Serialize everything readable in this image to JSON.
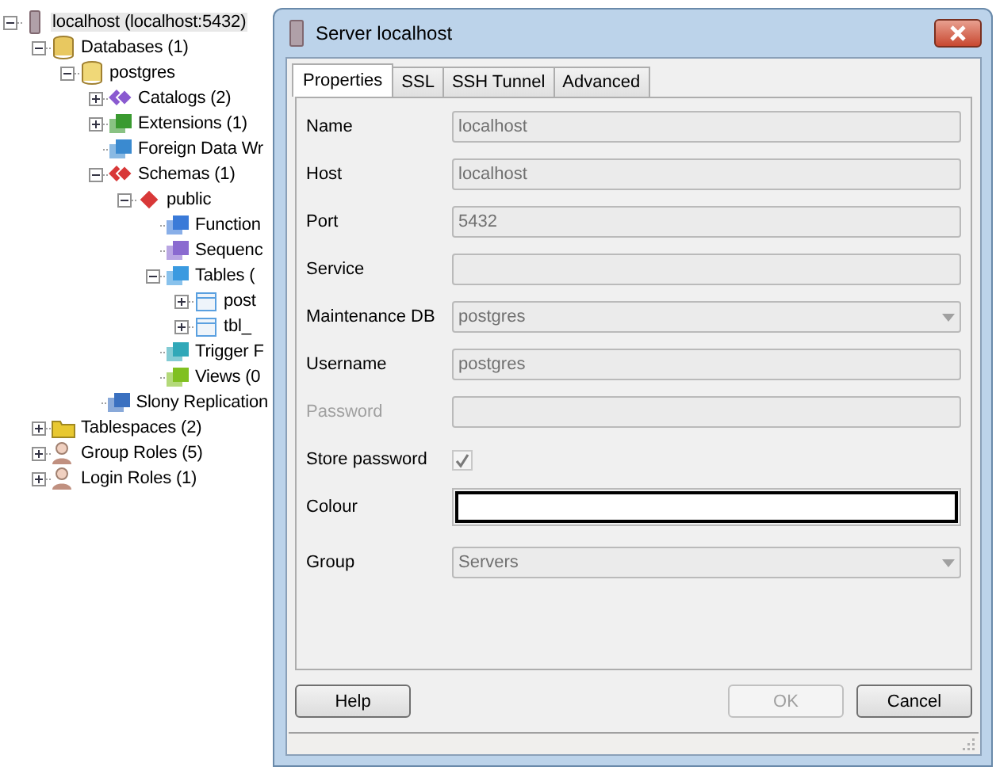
{
  "tree": [
    {
      "label": "localhost (localhost:5432)",
      "kind": "server",
      "selected": true,
      "expanded": true,
      "children": [
        {
          "label": "Databases (1)",
          "kind": "databases",
          "selected": false,
          "expanded": true,
          "children": [
            {
              "label": "postgres",
              "kind": "database",
              "selected": false,
              "expanded": true,
              "children": [
                {
                  "label": "Catalogs (2)",
                  "kind": "catalogs",
                  "selected": false,
                  "expanded": false
                },
                {
                  "label": "Extensions (1)",
                  "kind": "extensions",
                  "selected": false,
                  "expanded": false
                },
                {
                  "label": "Foreign Data Wr",
                  "kind": "fdw",
                  "selected": false
                },
                {
                  "label": "Schemas (1)",
                  "kind": "schemas",
                  "selected": false,
                  "expanded": true,
                  "children": [
                    {
                      "label": "public",
                      "kind": "schema",
                      "selected": false,
                      "expanded": true,
                      "children": [
                        {
                          "label": "Function",
                          "kind": "functions",
                          "selected": false
                        },
                        {
                          "label": "Sequenc",
                          "kind": "sequences",
                          "selected": false
                        },
                        {
                          "label": "Tables (",
                          "kind": "tables",
                          "selected": false,
                          "expanded": true,
                          "children": [
                            {
                              "label": "post",
                              "kind": "table",
                              "selected": false,
                              "expanded": false
                            },
                            {
                              "label": "tbl_",
                              "kind": "table",
                              "selected": false,
                              "expanded": false
                            }
                          ]
                        },
                        {
                          "label": "Trigger F",
                          "kind": "triggers",
                          "selected": false
                        },
                        {
                          "label": "Views (0",
                          "kind": "views",
                          "selected": false
                        }
                      ]
                    }
                  ]
                },
                {
                  "label": "Slony Replication",
                  "kind": "slony",
                  "selected": false
                }
              ]
            }
          ]
        },
        {
          "label": "Tablespaces (2)",
          "kind": "tablespaces",
          "selected": false,
          "expanded": false
        },
        {
          "label": "Group Roles (5)",
          "kind": "grouproles",
          "selected": false,
          "expanded": false
        },
        {
          "label": "Login Roles (1)",
          "kind": "loginroles",
          "selected": false,
          "expanded": false
        }
      ]
    }
  ],
  "dialog": {
    "title": "Server localhost",
    "tabs": [
      {
        "label": "Properties",
        "selected": true
      },
      {
        "label": "SSL",
        "selected": false
      },
      {
        "label": "SSH Tunnel",
        "selected": false
      },
      {
        "label": "Advanced",
        "selected": false
      }
    ],
    "fields": [
      {
        "label": "Name",
        "kind": "text",
        "value": "localhost",
        "disabled": true,
        "label_disabled": false
      },
      {
        "label": "Host",
        "kind": "text",
        "value": "localhost",
        "disabled": true,
        "label_disabled": false
      },
      {
        "label": "Port",
        "kind": "text",
        "value": "5432",
        "disabled": true,
        "label_disabled": false
      },
      {
        "label": "Service",
        "kind": "text",
        "disabled": true,
        "label_disabled": false
      },
      {
        "label": "Maintenance DB",
        "kind": "combo",
        "value": "postgres",
        "disabled": true,
        "label_disabled": false
      },
      {
        "label": "Username",
        "kind": "text",
        "value": "postgres",
        "disabled": true,
        "label_disabled": false
      },
      {
        "label": "Password",
        "kind": "text",
        "disabled": true,
        "label_disabled": true
      },
      {
        "label": "Store password",
        "kind": "checkbox",
        "checked": true,
        "disabled": true,
        "label_disabled": false
      },
      {
        "label": "Colour",
        "kind": "colour",
        "color": "#ffffff",
        "disabled": false,
        "label_disabled": false
      },
      {
        "label": "Group",
        "kind": "combo",
        "value": "Servers",
        "disabled": true,
        "label_disabled": false
      }
    ],
    "buttons": [
      {
        "label": "Help",
        "disabled": false
      },
      {
        "label": "OK",
        "disabled": true
      },
      {
        "label": "Cancel",
        "disabled": false
      }
    ]
  }
}
